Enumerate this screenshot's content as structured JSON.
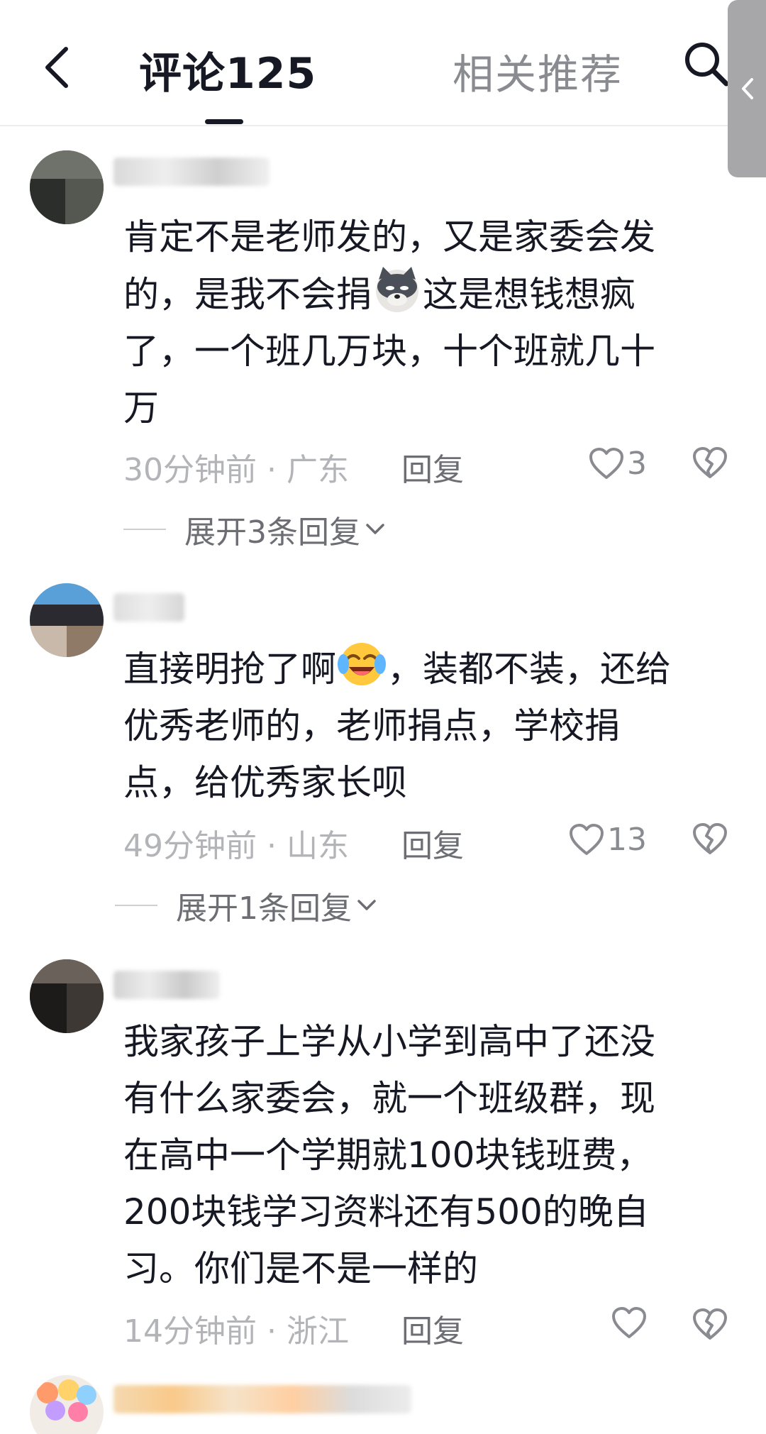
{
  "header": {
    "tab_comments_label": "评论125",
    "tab_related_label": "相关推荐",
    "icons": {
      "back": "chevron-left-icon",
      "search": "search-icon",
      "side_handle": "chevron-left-icon"
    }
  },
  "comments": [
    {
      "lines": [
        "肯定不是老师发的，又是家委会发",
        "的，是我不会捐",
        "这是想钱想疯",
        "了，一个班几万块，十个班就几十",
        "万"
      ],
      "emoji": "doge-emoji",
      "time": "30分钟前 · 广东",
      "reply_label": "回复",
      "likes": "3",
      "expand_label": "展开3条回复"
    },
    {
      "lines": [
        "直接明抢了啊",
        "，装都不装，还给",
        "优秀老师的，老师捐点，学校捐",
        "点，给优秀家长呗"
      ],
      "emoji": "laugh-cry-emoji",
      "time": "49分钟前 · 山东",
      "reply_label": "回复",
      "likes": "13",
      "expand_label": "展开1条回复"
    },
    {
      "lines": [
        "我家孩子上学从小学到高中了还没",
        "有什么家委会，就一个班级群，现",
        "在高中一个学期就100块钱班费，",
        "200块钱学习资料还有500的晚自",
        "习。你们是不是一样的"
      ],
      "time": "14分钟前 · 浙江",
      "reply_label": "回复",
      "likes": ""
    }
  ],
  "colors": {
    "text": "#161823",
    "meta": "#b3b4b8",
    "secondary": "#8a8b91"
  }
}
